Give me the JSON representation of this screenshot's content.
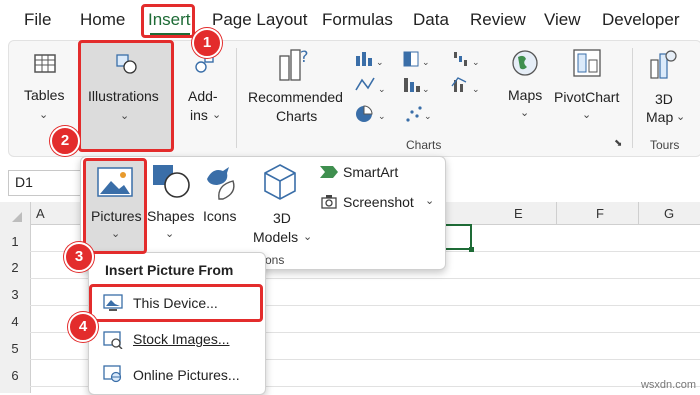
{
  "menu": {
    "tabs": [
      "File",
      "Home",
      "Insert",
      "Page Layout",
      "Formulas",
      "Data",
      "Review",
      "View",
      "Developer"
    ],
    "active_tab": "Insert"
  },
  "ribbon": {
    "tables_label": "Tables",
    "illustrations_label": "Illustrations",
    "addins_line1": "Add-",
    "addins_line2": "ins",
    "recommended_line1": "Recommended",
    "recommended_line2": "Charts",
    "maps_label": "Maps",
    "pivotchart_label": "PivotChart",
    "map3d_line1": "3D",
    "map3d_line2": "Map",
    "charts_group": "Charts",
    "tours_group": "Tours"
  },
  "formula_bar": {
    "name_box": "D1"
  },
  "grid": {
    "columns": [
      "A",
      "E",
      "F",
      "G"
    ],
    "rows": [
      "1",
      "2",
      "3",
      "4",
      "5",
      "6"
    ]
  },
  "illustrations_menu": {
    "pictures": "Pictures",
    "shapes": "Shapes",
    "icons": "Icons",
    "models_line1": "3D",
    "models_line2": "Models",
    "smartart": "SmartArt",
    "screenshot": "Screenshot",
    "group_label_partial": "tions"
  },
  "pictures_menu": {
    "header": "Insert Picture From",
    "items": [
      "This Device...",
      "Stock Images...",
      "Online Pictures..."
    ]
  },
  "callouts": [
    "1",
    "2",
    "3",
    "4"
  ],
  "watermark": "wsxdn.com",
  "colors": {
    "accent": "#1e6b36",
    "callout": "#e32c2c"
  }
}
